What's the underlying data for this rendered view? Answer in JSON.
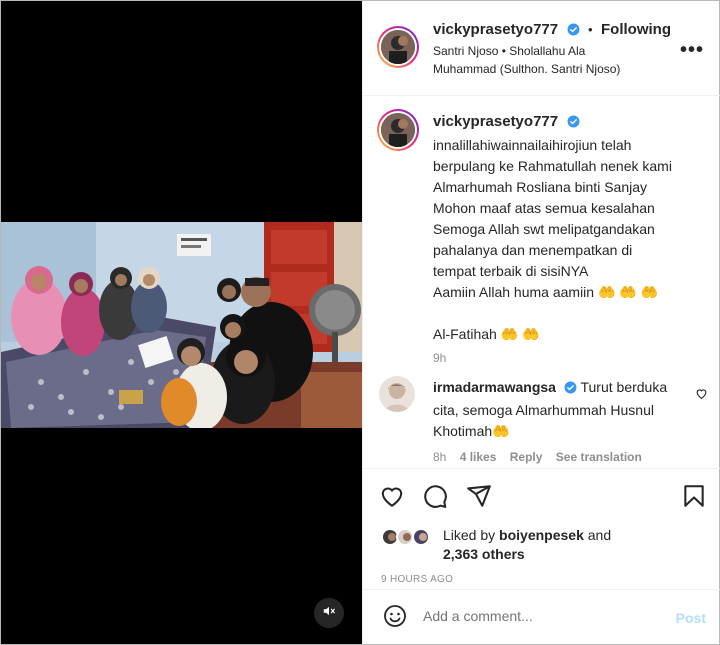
{
  "post": {
    "username": "vickyprasetyo777",
    "dot_separator": "•",
    "follow_status": "Following",
    "audio_line1": "Santri Njoso • Sholallahu Ala",
    "audio_line2": "Muhammad (Sulthon. Santri Njoso)",
    "more_label": "•••"
  },
  "caption": {
    "username": "vickyprasetyo777",
    "lines": [
      "innalillahiwainnailaihirojiun telah",
      "berpulang ke Rahmatullah nenek kami",
      "Almarhumah Rosliana binti Sanjay",
      "Mohon maaf atas semua kesalahan",
      "Semoga Allah swt melipatgandakan",
      "pahalanya dan menempatkan di",
      "tempat terbaik di sisiNYA",
      "Aamiin Allah huma aamiin 🤲 🤲 🤲"
    ],
    "footer_line": "Al-Fatihah 🤲 🤲",
    "time_ago": "9h"
  },
  "comment": {
    "username": "irmadarmawangsa",
    "line1": "Turut berduka",
    "line2": "cita, semoga Almarhummah Husnul",
    "line3": "Khotimah🤲",
    "time_ago": "8h",
    "likes": "4 likes",
    "reply": "Reply",
    "translate": "See translation"
  },
  "likes": {
    "prefix": "Liked by",
    "user": "boiyenpesek",
    "and": "and",
    "count": "2,363 others"
  },
  "timestamp": "9 HOURS AGO",
  "composer": {
    "placeholder": "Add a comment...",
    "post_label": "Post"
  },
  "icons": {
    "like": "heart-icon",
    "comment": "comment-icon",
    "share": "share-icon",
    "save": "bookmark-icon",
    "emoji": "emoji-icon",
    "mute": "speaker-muted-icon"
  },
  "colors": {
    "verified": "#3897f0",
    "post_disabled": "#b2dffc",
    "muted_text": "#8e8e8e",
    "media_bg": "#000000"
  }
}
